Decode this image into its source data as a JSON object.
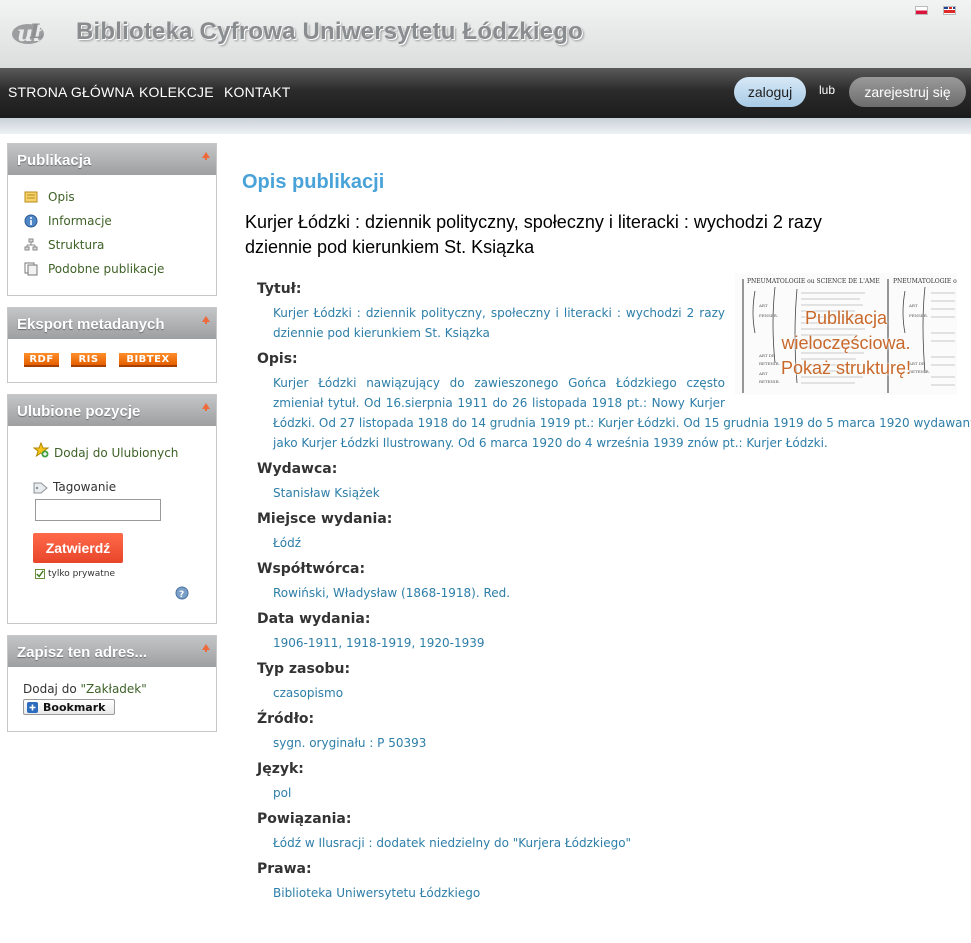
{
  "header": {
    "site_title": "Biblioteka Cyfrowa Uniwersytetu Łódzkiego",
    "logo_icon": "bcul-logo",
    "languages": [
      "pl-flag-icon",
      "en-flag-icon"
    ]
  },
  "nav": {
    "items": [
      "STRONA GŁÓWNA",
      "KOLEKCJE",
      "KONTAKT"
    ],
    "login": "zaloguj",
    "or": "lub",
    "register": "zarejestruj się"
  },
  "sidebar": {
    "publication": {
      "title": "Publikacja",
      "items": [
        "Opis",
        "Informacje",
        "Struktura",
        "Podobne publikacje"
      ]
    },
    "export": {
      "title": "Eksport metadanych",
      "buttons": [
        "RDF",
        "RIS",
        "BIBTEX"
      ]
    },
    "favorites": {
      "title": "Ulubione pozycje",
      "add": "Dodaj do Ulubionych",
      "tagging": "Tagowanie",
      "tag_value": "",
      "submit": "Zatwierdź",
      "private": "tylko prywatne"
    },
    "bookmark": {
      "title": "Zapisz ten adres...",
      "add_prefix": "Dodaj do ",
      "add_link": "\"Zakładek\"",
      "button": "Bookmark"
    }
  },
  "content": {
    "section_title": "Opis publikacji",
    "pub_title": "Kurjer Łódzki : dziennik polityczny, społeczny i literacki : wychodzi 2 razy dziennie pod kierunkiem St. Ksiązka",
    "thumbnail_overlay": [
      "Publikacja",
      "wieloczęściowa.",
      "Pokaż strukturę!"
    ],
    "fields": [
      {
        "label": "Tytuł:",
        "value": "Kurjer Łódzki : dziennik polityczny, społeczny i literacki : wychodzi 2 razy dziennie pod kierunkiem St. Ksiązka"
      },
      {
        "label": "Opis:",
        "value": "Kurjer Łódzki nawiązujący do zawieszonego Gońca Łódzkiego często zmieniał tytuł. Od 16.sierpnia 1911 do 26 listopada 1918 pt.: Nowy Kurjer Łódzki. Od 27 listopada 1918 do 14 grudnia 1919 pt.: Kurjer Łódzki. Od 15 grudnia 1919 do 5 marca 1920 wydawany jako Kurjer Łódzki Ilustrowany. Od 6 marca 1920 do 4 września 1939 znów pt.: Kurjer Łódzki."
      },
      {
        "label": "Wydawca:",
        "value": "Stanisław Książek"
      },
      {
        "label": "Miejsce wydania:",
        "value": "Łódź"
      },
      {
        "label": "Współtwórca:",
        "value": "Rowiński, Władysław (1868-1918). Red."
      },
      {
        "label": "Data wydania:",
        "value": "1906-1911, 1918-1919, 1920-1939"
      },
      {
        "label": "Typ zasobu:",
        "value": "czasopismo"
      },
      {
        "label": "Źródło:",
        "value": "sygn. oryginału : P 50393"
      },
      {
        "label": "Język:",
        "value": "pol"
      },
      {
        "label": "Powiązania:",
        "value": "Łódź w Ilusracji : dodatek niedzielny do \"Kurjera Łódzkiego\""
      },
      {
        "label": "Prawa:",
        "value": "Biblioteka Uniwersytetu Łódzkiego"
      }
    ],
    "opis_lines": [
      "Kurjer Łódzki nawiązujący do zawieszonego Gońca Łódzkiego często",
      "zmieniał tytuł. Od 16.sierpnia 1911 do 26 listopada 1918 pt.: Nowy Kurjer",
      "Łódzki. Od 27 listopada 1918 do 14 grudnia 1919 pt.: Kurjer Łódzki. Od 15 grudnia 1919 do 5 marca 1920 wydawany",
      "jako Kurjer Łódzki Ilustrowany. Od 6 marca 1920 do 4 września 1939 znów pt.: Kurjer Łódzki."
    ],
    "title_lines": [
      "Kurjer Łódzki : dziennik polityczny, społeczny i literacki : wychodzi 2 razy",
      "dziennie pod kierunkiem St. Ksiązka"
    ]
  },
  "colors": {
    "accent": "#4aa3d8",
    "link": "#2d7ea8",
    "sidebar_link": "#3f6228",
    "submit": "#f05a3a",
    "export": "#ff7a14"
  }
}
